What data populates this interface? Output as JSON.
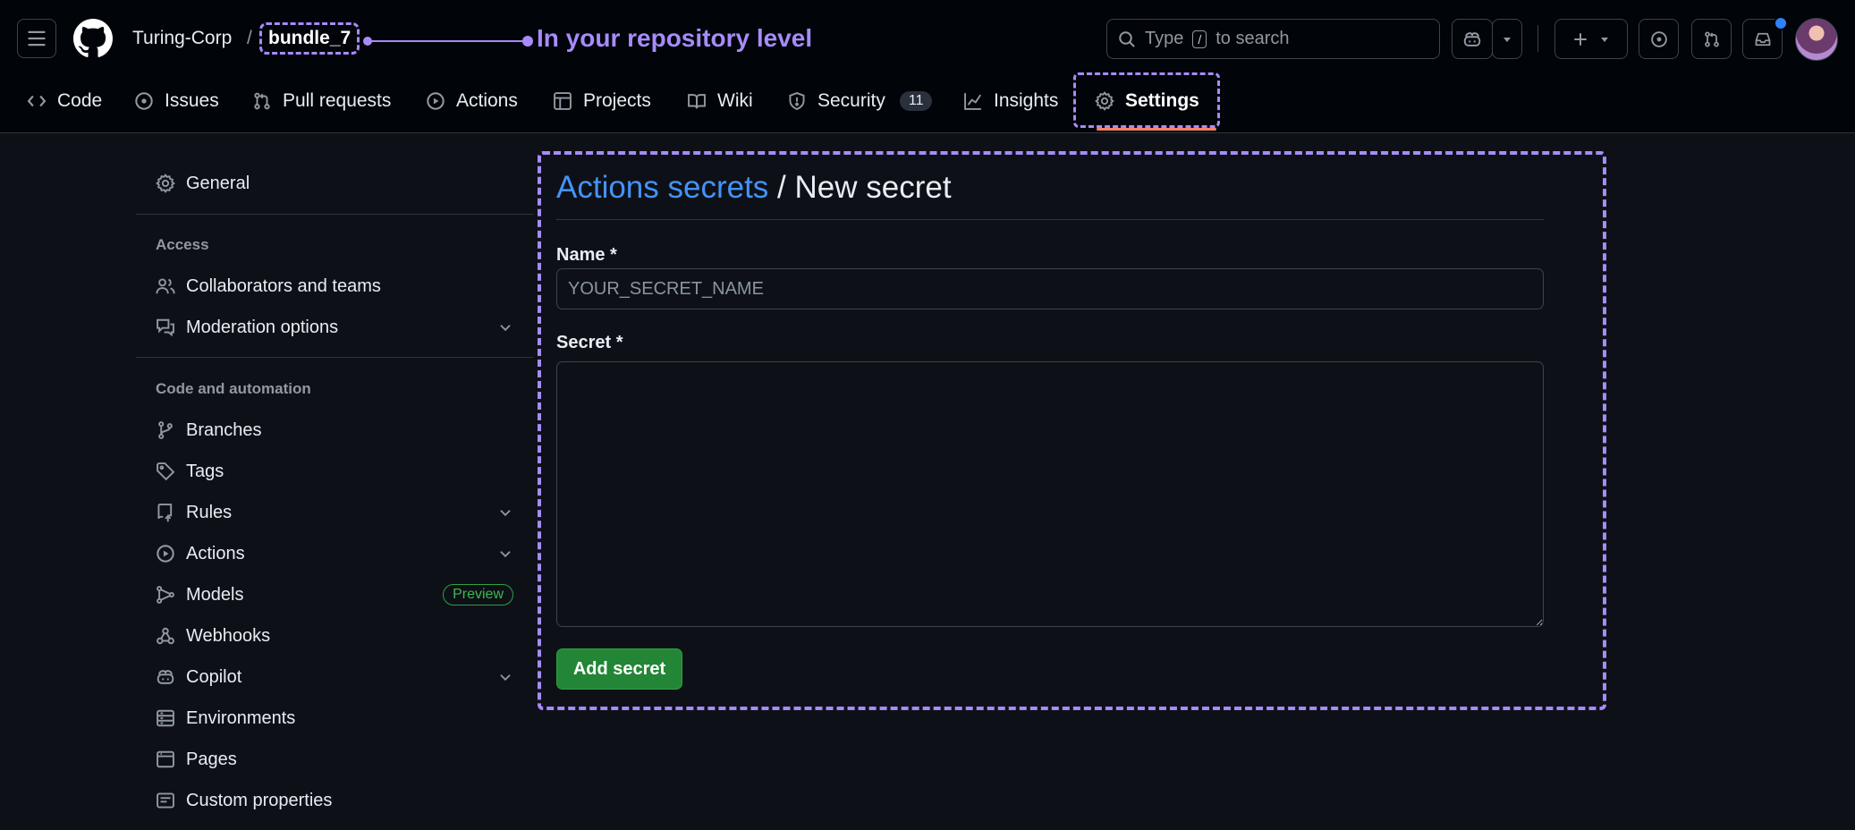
{
  "header": {
    "owner": "Turing-Corp",
    "separator": "/",
    "repo": "bundle_7",
    "annotation": "In your repository level",
    "search_text": "Type",
    "search_kbd": "/",
    "search_suffix": "to search"
  },
  "tabs": [
    {
      "label": "Code",
      "icon": "code-icon"
    },
    {
      "label": "Issues",
      "icon": "issue-icon"
    },
    {
      "label": "Pull requests",
      "icon": "pull-request-icon"
    },
    {
      "label": "Actions",
      "icon": "play-icon"
    },
    {
      "label": "Projects",
      "icon": "table-icon"
    },
    {
      "label": "Wiki",
      "icon": "book-icon"
    },
    {
      "label": "Security",
      "icon": "shield-icon",
      "count": "11"
    },
    {
      "label": "Insights",
      "icon": "graph-icon"
    },
    {
      "label": "Settings",
      "icon": "gear-icon",
      "selected": true
    }
  ],
  "sidebar": {
    "general": "General",
    "access_heading": "Access",
    "access_items": [
      {
        "label": "Collaborators and teams",
        "icon": "people-icon"
      },
      {
        "label": "Moderation options",
        "icon": "comment-discussion-icon",
        "expandable": true
      }
    ],
    "code_heading": "Code and automation",
    "code_items": [
      {
        "label": "Branches",
        "icon": "git-branch-icon"
      },
      {
        "label": "Tags",
        "icon": "tag-icon"
      },
      {
        "label": "Rules",
        "icon": "repo-push-icon",
        "expandable": true
      },
      {
        "label": "Actions",
        "icon": "play-icon",
        "expandable": true
      },
      {
        "label": "Models",
        "icon": "models-icon",
        "badge": "Preview"
      },
      {
        "label": "Webhooks",
        "icon": "webhook-icon"
      },
      {
        "label": "Copilot",
        "icon": "copilot-icon",
        "expandable": true
      },
      {
        "label": "Environments",
        "icon": "server-icon"
      },
      {
        "label": "Pages",
        "icon": "browser-icon"
      },
      {
        "label": "Custom properties",
        "icon": "note-icon"
      }
    ]
  },
  "main": {
    "breadcrumb_link": "Actions secrets",
    "breadcrumb_sep": " / ",
    "breadcrumb_current": "New secret",
    "name_label": "Name *",
    "name_placeholder": "YOUR_SECRET_NAME",
    "name_value": "",
    "secret_label": "Secret *",
    "secret_value": "",
    "submit_label": "Add secret"
  },
  "colors": {
    "background": "#0d1117",
    "header_bg": "#010409",
    "link": "#4493f8",
    "primary_button": "#238636",
    "annotation": "#a78bfa",
    "selected_tab_underline": "#f78166"
  }
}
